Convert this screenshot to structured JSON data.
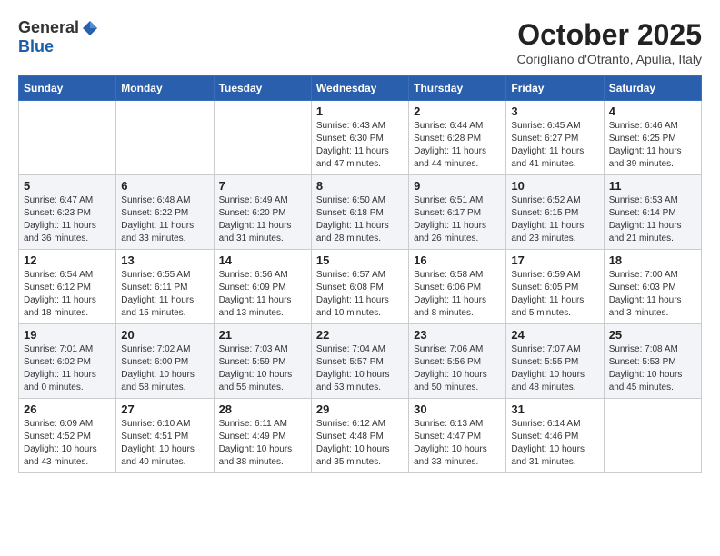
{
  "header": {
    "logo_general": "General",
    "logo_blue": "Blue",
    "month": "October 2025",
    "location": "Corigliano d'Otranto, Apulia, Italy"
  },
  "days_of_week": [
    "Sunday",
    "Monday",
    "Tuesday",
    "Wednesday",
    "Thursday",
    "Friday",
    "Saturday"
  ],
  "weeks": [
    [
      {
        "day": "",
        "info": ""
      },
      {
        "day": "",
        "info": ""
      },
      {
        "day": "",
        "info": ""
      },
      {
        "day": "1",
        "info": "Sunrise: 6:43 AM\nSunset: 6:30 PM\nDaylight: 11 hours\nand 47 minutes."
      },
      {
        "day": "2",
        "info": "Sunrise: 6:44 AM\nSunset: 6:28 PM\nDaylight: 11 hours\nand 44 minutes."
      },
      {
        "day": "3",
        "info": "Sunrise: 6:45 AM\nSunset: 6:27 PM\nDaylight: 11 hours\nand 41 minutes."
      },
      {
        "day": "4",
        "info": "Sunrise: 6:46 AM\nSunset: 6:25 PM\nDaylight: 11 hours\nand 39 minutes."
      }
    ],
    [
      {
        "day": "5",
        "info": "Sunrise: 6:47 AM\nSunset: 6:23 PM\nDaylight: 11 hours\nand 36 minutes."
      },
      {
        "day": "6",
        "info": "Sunrise: 6:48 AM\nSunset: 6:22 PM\nDaylight: 11 hours\nand 33 minutes."
      },
      {
        "day": "7",
        "info": "Sunrise: 6:49 AM\nSunset: 6:20 PM\nDaylight: 11 hours\nand 31 minutes."
      },
      {
        "day": "8",
        "info": "Sunrise: 6:50 AM\nSunset: 6:18 PM\nDaylight: 11 hours\nand 28 minutes."
      },
      {
        "day": "9",
        "info": "Sunrise: 6:51 AM\nSunset: 6:17 PM\nDaylight: 11 hours\nand 26 minutes."
      },
      {
        "day": "10",
        "info": "Sunrise: 6:52 AM\nSunset: 6:15 PM\nDaylight: 11 hours\nand 23 minutes."
      },
      {
        "day": "11",
        "info": "Sunrise: 6:53 AM\nSunset: 6:14 PM\nDaylight: 11 hours\nand 21 minutes."
      }
    ],
    [
      {
        "day": "12",
        "info": "Sunrise: 6:54 AM\nSunset: 6:12 PM\nDaylight: 11 hours\nand 18 minutes."
      },
      {
        "day": "13",
        "info": "Sunrise: 6:55 AM\nSunset: 6:11 PM\nDaylight: 11 hours\nand 15 minutes."
      },
      {
        "day": "14",
        "info": "Sunrise: 6:56 AM\nSunset: 6:09 PM\nDaylight: 11 hours\nand 13 minutes."
      },
      {
        "day": "15",
        "info": "Sunrise: 6:57 AM\nSunset: 6:08 PM\nDaylight: 11 hours\nand 10 minutes."
      },
      {
        "day": "16",
        "info": "Sunrise: 6:58 AM\nSunset: 6:06 PM\nDaylight: 11 hours\nand 8 minutes."
      },
      {
        "day": "17",
        "info": "Sunrise: 6:59 AM\nSunset: 6:05 PM\nDaylight: 11 hours\nand 5 minutes."
      },
      {
        "day": "18",
        "info": "Sunrise: 7:00 AM\nSunset: 6:03 PM\nDaylight: 11 hours\nand 3 minutes."
      }
    ],
    [
      {
        "day": "19",
        "info": "Sunrise: 7:01 AM\nSunset: 6:02 PM\nDaylight: 11 hours\nand 0 minutes."
      },
      {
        "day": "20",
        "info": "Sunrise: 7:02 AM\nSunset: 6:00 PM\nDaylight: 10 hours\nand 58 minutes."
      },
      {
        "day": "21",
        "info": "Sunrise: 7:03 AM\nSunset: 5:59 PM\nDaylight: 10 hours\nand 55 minutes."
      },
      {
        "day": "22",
        "info": "Sunrise: 7:04 AM\nSunset: 5:57 PM\nDaylight: 10 hours\nand 53 minutes."
      },
      {
        "day": "23",
        "info": "Sunrise: 7:06 AM\nSunset: 5:56 PM\nDaylight: 10 hours\nand 50 minutes."
      },
      {
        "day": "24",
        "info": "Sunrise: 7:07 AM\nSunset: 5:55 PM\nDaylight: 10 hours\nand 48 minutes."
      },
      {
        "day": "25",
        "info": "Sunrise: 7:08 AM\nSunset: 5:53 PM\nDaylight: 10 hours\nand 45 minutes."
      }
    ],
    [
      {
        "day": "26",
        "info": "Sunrise: 6:09 AM\nSunset: 4:52 PM\nDaylight: 10 hours\nand 43 minutes."
      },
      {
        "day": "27",
        "info": "Sunrise: 6:10 AM\nSunset: 4:51 PM\nDaylight: 10 hours\nand 40 minutes."
      },
      {
        "day": "28",
        "info": "Sunrise: 6:11 AM\nSunset: 4:49 PM\nDaylight: 10 hours\nand 38 minutes."
      },
      {
        "day": "29",
        "info": "Sunrise: 6:12 AM\nSunset: 4:48 PM\nDaylight: 10 hours\nand 35 minutes."
      },
      {
        "day": "30",
        "info": "Sunrise: 6:13 AM\nSunset: 4:47 PM\nDaylight: 10 hours\nand 33 minutes."
      },
      {
        "day": "31",
        "info": "Sunrise: 6:14 AM\nSunset: 4:46 PM\nDaylight: 10 hours\nand 31 minutes."
      },
      {
        "day": "",
        "info": ""
      }
    ]
  ]
}
